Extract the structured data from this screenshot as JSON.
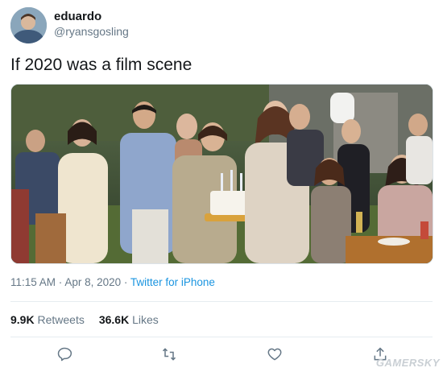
{
  "user": {
    "display_name": "eduardo",
    "handle": "@ryansgosling"
  },
  "tweet": {
    "text": "If 2020 was a film scene",
    "image_alt": "Scene from a film: people applauding at an outdoor garden party as a woman carries a birthday cake with candles"
  },
  "meta": {
    "time": "11:15 AM",
    "separator": " · ",
    "date": "Apr 8, 2020",
    "source": "Twitter for iPhone"
  },
  "stats": {
    "retweets_count": "9.9K",
    "retweets_label": "Retweets",
    "likes_count": "36.6K",
    "likes_label": "Likes"
  },
  "actions": {
    "reply_icon": "reply-icon",
    "retweet_icon": "retweet-icon",
    "like_icon": "heart-icon",
    "share_icon": "share-icon"
  },
  "watermark": "GAMERSKY",
  "colors": {
    "link": "#1b95e0",
    "secondary_text": "#657786",
    "primary_text": "#14171a"
  }
}
